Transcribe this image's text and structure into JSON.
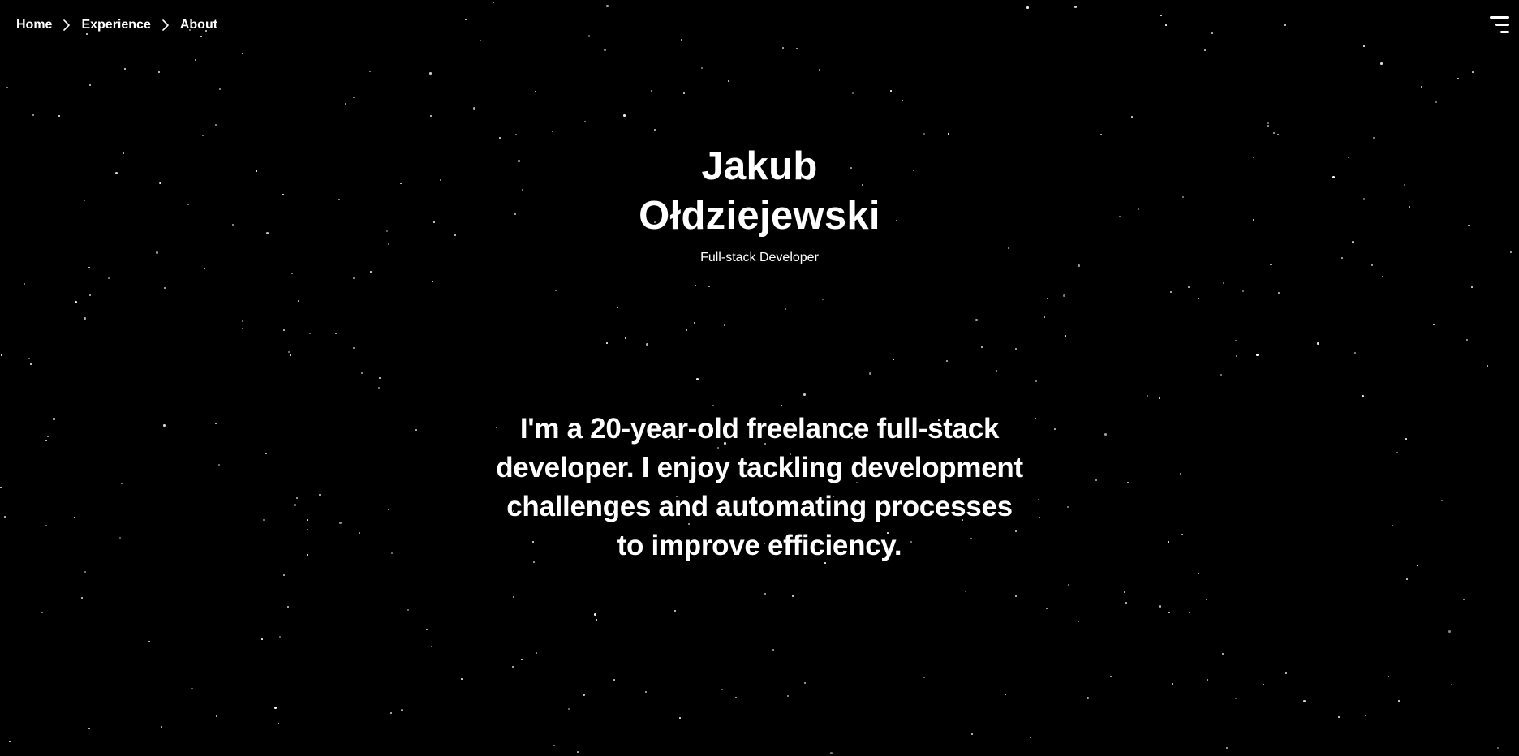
{
  "breadcrumb": {
    "items": [
      {
        "label": "Home"
      },
      {
        "label": "Experience"
      },
      {
        "label": "About"
      }
    ],
    "separator_icon": "chevron-right-icon"
  },
  "menu": {
    "icon": "hamburger-menu-icon"
  },
  "hero": {
    "name_line1": "Jakub",
    "name_line2": "Ołdziejewski",
    "role": "Full-stack Developer"
  },
  "bio": {
    "text": "I'm a 20-year-old freelance full-stack developer. I enjoy tackling development challenges and automating processes to improve efficiency."
  },
  "colors": {
    "background": "#000000",
    "text": "#ffffff"
  }
}
